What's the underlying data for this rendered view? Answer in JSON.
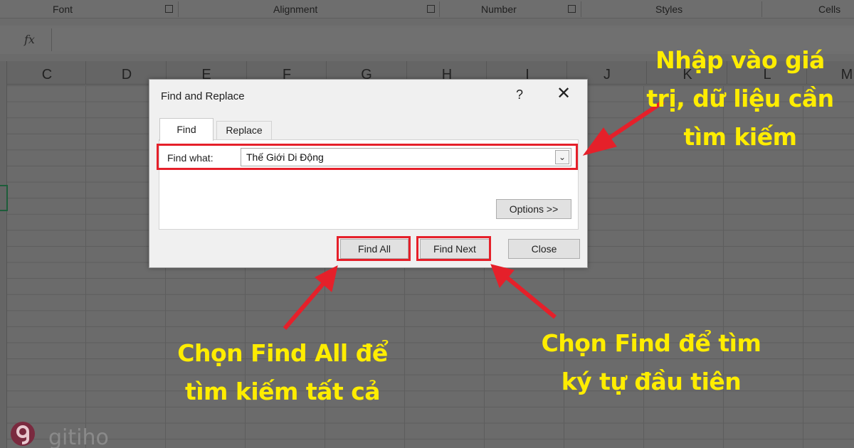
{
  "ribbon": {
    "groups": [
      "Font",
      "Alignment",
      "Number",
      "Styles",
      "Cells"
    ]
  },
  "formula_bar": {
    "fx_label": "fx"
  },
  "columns": [
    "C",
    "D",
    "E",
    "F",
    "G",
    "H",
    "I",
    "J",
    "K",
    "L",
    "M"
  ],
  "dialog": {
    "title": "Find and Replace",
    "help": "?",
    "close": "✕",
    "tabs": [
      "Find",
      "Replace"
    ],
    "find_what_label": "Find what:",
    "find_what_value": "Thế Giới Di Động",
    "options_label": "Options >>",
    "find_all_label": "Find All",
    "find_next_label": "Find Next",
    "close_label": "Close"
  },
  "annotations": {
    "top_right": [
      "Nhập vào giá",
      "trị, dữ liệu cần",
      "tìm kiếm"
    ],
    "bottom_left": [
      "Chọn Find All để",
      "tìm kiếm tất cả"
    ],
    "bottom_right": [
      "Chọn Find để tìm",
      "ký tự đầu tiên"
    ]
  },
  "watermark": {
    "text": "gitiho"
  },
  "colors": {
    "highlight": "#e5202a",
    "annotation_text": "#ffed00",
    "overlay": "#6b6b6b"
  }
}
